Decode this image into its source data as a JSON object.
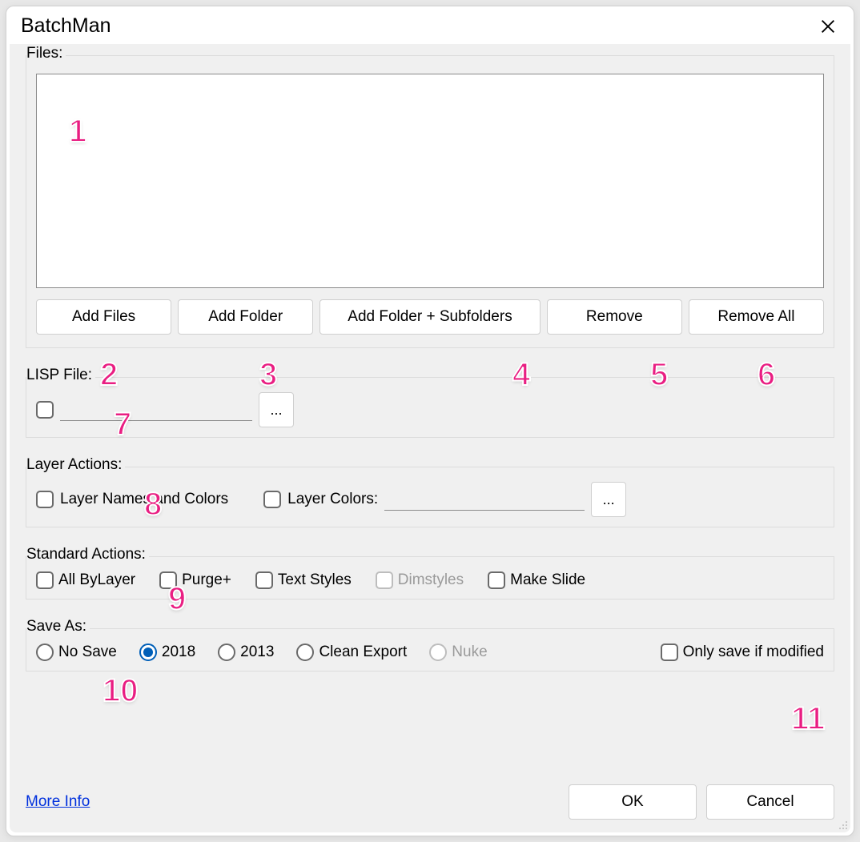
{
  "window": {
    "title": "BatchMan"
  },
  "files": {
    "legend": "Files:",
    "buttons": {
      "add_files": "Add Files",
      "add_folder": "Add Folder",
      "add_folder_sub": "Add Folder + Subfolders",
      "remove": "Remove",
      "remove_all": "Remove All"
    }
  },
  "lisp": {
    "legend": "LISP File:",
    "path": "",
    "browse": "..."
  },
  "layer": {
    "legend": "Layer Actions:",
    "names_colors": "Layer Names and Colors",
    "colors": "Layer Colors:",
    "colors_path": "",
    "browse": "..."
  },
  "std": {
    "legend": "Standard Actions:",
    "all_bylayer": "All ByLayer",
    "purge": "Purge+",
    "text_styles": "Text Styles",
    "dimstyles": "Dimstyles",
    "make_slide": "Make Slide"
  },
  "save": {
    "legend": "Save As:",
    "no_save": "No Save",
    "v2018": "2018",
    "v2013": "2013",
    "clean_export": "Clean Export",
    "nuke": "Nuke",
    "only_modified": "Only save if modified",
    "selected": "v2018"
  },
  "footer": {
    "more_info": "More Info",
    "ok": "OK",
    "cancel": "Cancel"
  },
  "annotations": [
    "1",
    "2",
    "3",
    "4",
    "5",
    "6",
    "7",
    "8",
    "9",
    "10",
    "11"
  ]
}
